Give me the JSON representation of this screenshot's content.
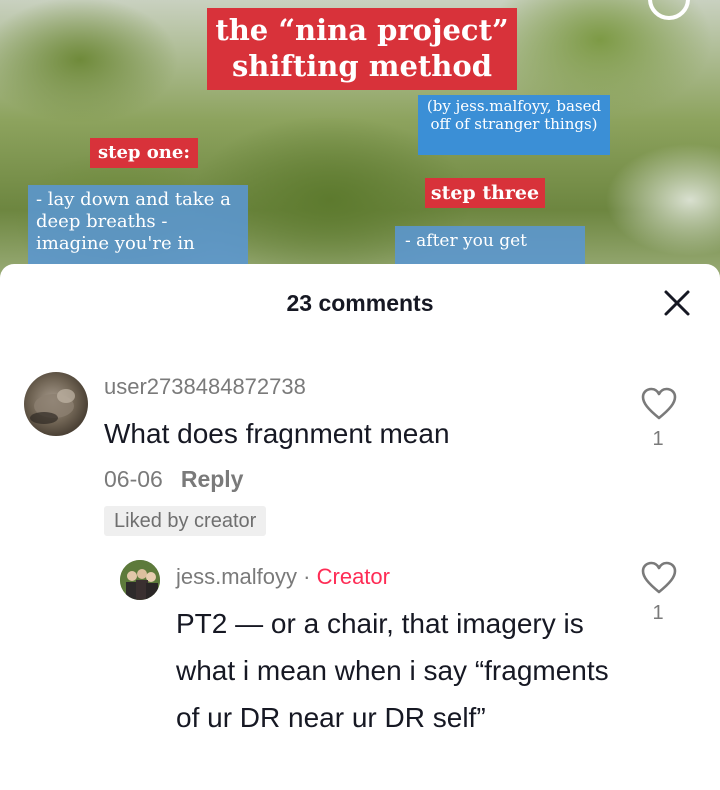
{
  "video": {
    "title": "the “nina project” shifting method",
    "credit": "(by jess.malfoyy, based off of stranger things)",
    "step_one_label": "step one:",
    "step_one_text": "- lay down and take a deep breaths - imagine you're in",
    "step_three_label": "step three",
    "step_three_text": "- after you get"
  },
  "sheet": {
    "comment_count": "23 comments",
    "close_icon": "close-icon"
  },
  "comments": [
    {
      "username": "user2738484872738",
      "text": "What does fragnment mean",
      "date": "06-06",
      "reply_label": "Reply",
      "liked_by_creator": "Liked by creator",
      "likes": "1",
      "heart_icon": "heart-outline-icon"
    },
    {
      "username": "jess.malfoyy",
      "separator": "·",
      "creator_label": "Creator",
      "text": "PT2 — or a chair, that imagery is what i mean when i say “fragments of ur DR near ur DR self”",
      "likes": "1",
      "heart_icon": "heart-outline-icon"
    }
  ],
  "colors": {
    "creator": "#fe2c55",
    "tag_red": "#d8323a",
    "tag_blue": "#3b8fd6"
  }
}
